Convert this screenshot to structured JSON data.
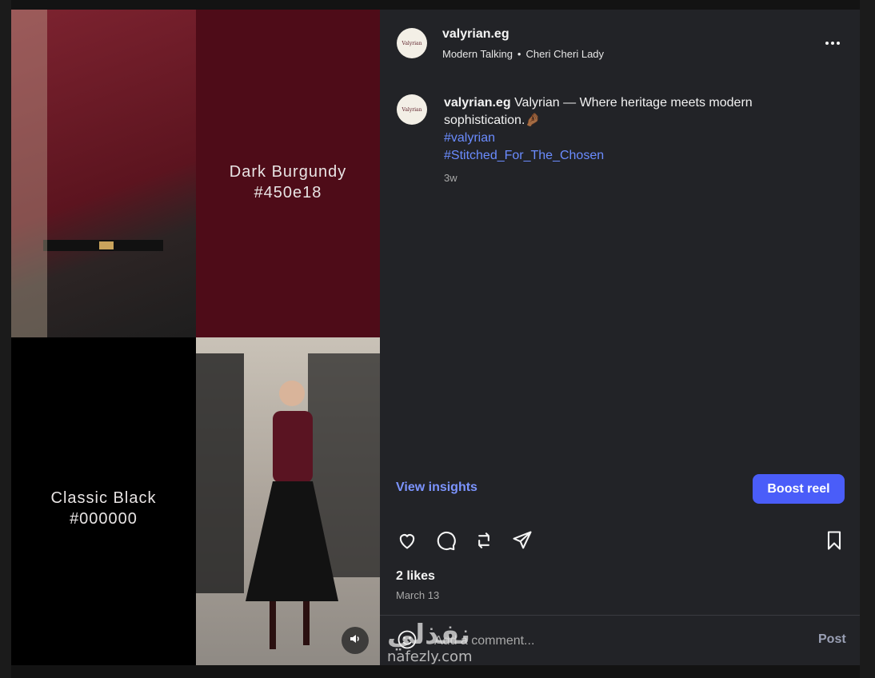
{
  "account": {
    "username": "valyrian.eg",
    "avatar_text": "Valyrian"
  },
  "audio": {
    "artist": "Modern Talking",
    "separator": "•",
    "track": "Cheri Cheri Lady"
  },
  "media": {
    "swatches": [
      {
        "name": "Dark Burgundy",
        "hex": "#450e18"
      },
      {
        "name": "Classic Black",
        "hex": "#000000"
      }
    ],
    "mute_icon": "volume-icon"
  },
  "caption": {
    "username": "valyrian.eg",
    "text": "Valyrian — Where heritage meets modern sophistication.",
    "emoji": "🤌🏾",
    "hashtags": [
      "#valyrian",
      "#Stitched_For_The_Chosen"
    ],
    "time": "3w"
  },
  "buttons": {
    "view_insights": "View insights",
    "boost": "Boost reel"
  },
  "actions": {
    "icons": [
      "heart-icon",
      "comment-icon",
      "repost-icon",
      "share-icon",
      "bookmark-icon"
    ]
  },
  "stats": {
    "likes": "2 likes",
    "date": "March 13"
  },
  "comment": {
    "placeholder": "Add a comment...",
    "post_label": "Post"
  },
  "watermark": {
    "arabic": "نفذلي",
    "latin": "nafezly.com"
  },
  "colors": {
    "accent": "#4a5df9",
    "link": "#6b8cff",
    "panel_bg": "#222327",
    "burgundy": "#450e18"
  }
}
